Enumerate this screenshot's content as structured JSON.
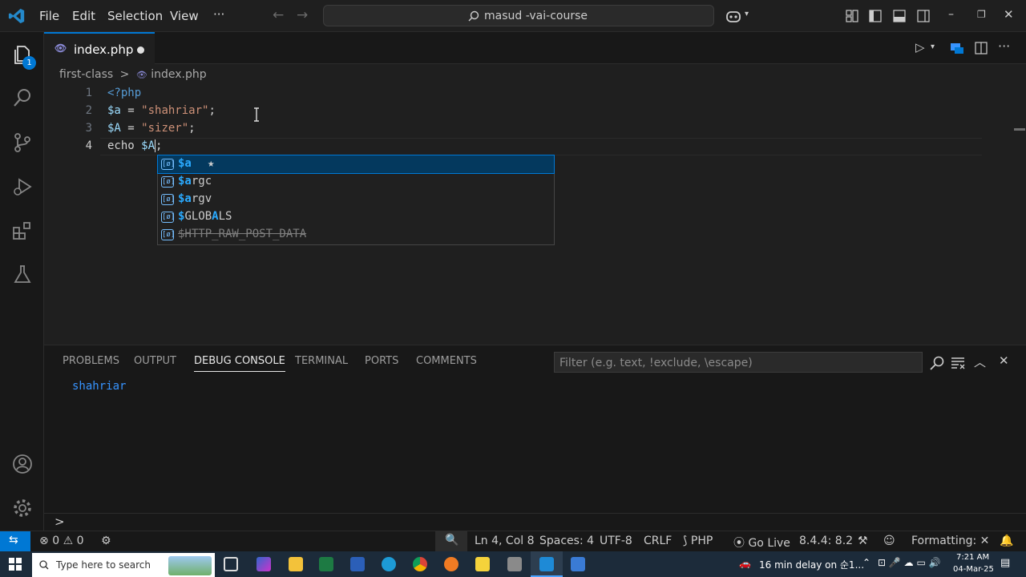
{
  "titlebar": {
    "menus": [
      "File",
      "Edit",
      "Selection",
      "View",
      "···"
    ],
    "search": "masud -vai-course"
  },
  "activity": {
    "explorer_badge": "1"
  },
  "tab": {
    "name": "index.php"
  },
  "breadcrumb": {
    "folder": "first-class",
    "sep": ">",
    "file": "index.php"
  },
  "editor": {
    "lines": [
      {
        "num": "1",
        "parts": [
          {
            "cls": "tag",
            "t": "<?php"
          }
        ]
      },
      {
        "num": "2",
        "parts": [
          {
            "cls": "var",
            "t": "$a"
          },
          {
            "cls": "pl",
            "t": " = "
          },
          {
            "cls": "str",
            "t": "\"shahriar\""
          },
          {
            "cls": "pl",
            "t": ";"
          }
        ]
      },
      {
        "num": "3",
        "parts": [
          {
            "cls": "var",
            "t": "$A"
          },
          {
            "cls": "pl",
            "t": " = "
          },
          {
            "cls": "str",
            "t": "\"sizer\""
          },
          {
            "cls": "pl",
            "t": ";"
          }
        ]
      },
      {
        "num": "4",
        "parts": [
          {
            "cls": "kw",
            "t": "echo "
          },
          {
            "cls": "var",
            "t": "$A"
          },
          {
            "cls": "pl",
            "t": ";"
          }
        ]
      }
    ]
  },
  "suggest": {
    "items": [
      {
        "label": "$a",
        "star": "★",
        "selected": true
      },
      {
        "label": "$argc"
      },
      {
        "label": "$argv"
      },
      {
        "label": "$GLOBALS"
      },
      {
        "label": "$HTTP_RAW_POST_DATA",
        "deprecated": true
      }
    ]
  },
  "panel": {
    "tabs": [
      "PROBLEMS",
      "OUTPUT",
      "DEBUG CONSOLE",
      "TERMINAL",
      "PORTS",
      "COMMENTS"
    ],
    "active_tab": "DEBUG CONSOLE",
    "filter_placeholder": "Filter (e.g. text, !exclude, \\escape)",
    "output": "shahriar",
    "prompt": ">"
  },
  "status": {
    "errors": "0",
    "warnings": "0",
    "position": "Ln 4, Col 8",
    "spaces": "Spaces: 4",
    "encoding": "UTF-8",
    "eol": "CRLF",
    "language": "PHP",
    "golive": "Go Live",
    "version": "8.4.4: 8.2",
    "formatting": "Formatting:"
  },
  "taskbar": {
    "search": "Type here to search",
    "notification": "16 min delay on 순1...",
    "time": "7:21 AM",
    "date": "04-Mar-25"
  },
  "colors": {
    "accent": "#0078d4",
    "string": "#ce9178",
    "variable": "#9cdcfe",
    "keyword": "#569cd6"
  }
}
